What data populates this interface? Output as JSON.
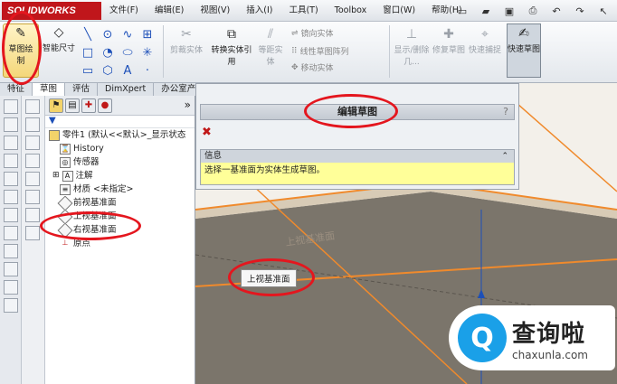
{
  "app": {
    "logo": "SOLIDWORKS"
  },
  "menu": [
    "文件(F)",
    "编辑(E)",
    "视图(V)",
    "插入(I)",
    "工具(T)",
    "Toolbox",
    "窗口(W)",
    "帮助(H)"
  ],
  "ribbon": {
    "sketch": "草图绘制",
    "smart_dim": "智能尺寸",
    "trim": "剪裁实体",
    "convert": "转换实体引用",
    "offset": "等距实体",
    "mirror": "镜向实体",
    "linear_pattern": "线性草图阵列",
    "move": "移动实体",
    "show_delete": "显示/删除几...",
    "repair": "修复草图",
    "snap": "快速捕捉",
    "quick_sketch": "快速草图"
  },
  "tabs": [
    "特征",
    "草图",
    "评估",
    "DimXpert",
    "办公室产品"
  ],
  "tree": {
    "root": "零件1 (默认<<默认>_显示状态",
    "items": [
      "History",
      "传感器",
      "注解",
      "材质 <未指定>",
      "前视基准面",
      "上视基准面",
      "右视基准面",
      "原点"
    ]
  },
  "property": {
    "title": "编辑草图",
    "help": "?",
    "info_title": "信息",
    "info_text": "选择一基准面为实体生成草图。"
  },
  "view_label": "上视基准面",
  "plane_tag": "上视基准面",
  "watermark": {
    "cn": "查询啦",
    "en": "chaxunla.com",
    "glyph": "Q"
  },
  "colors": {
    "accent": "#e4161e",
    "plane_fill": "#7b756b",
    "plane_edge": "#f08a2c"
  }
}
